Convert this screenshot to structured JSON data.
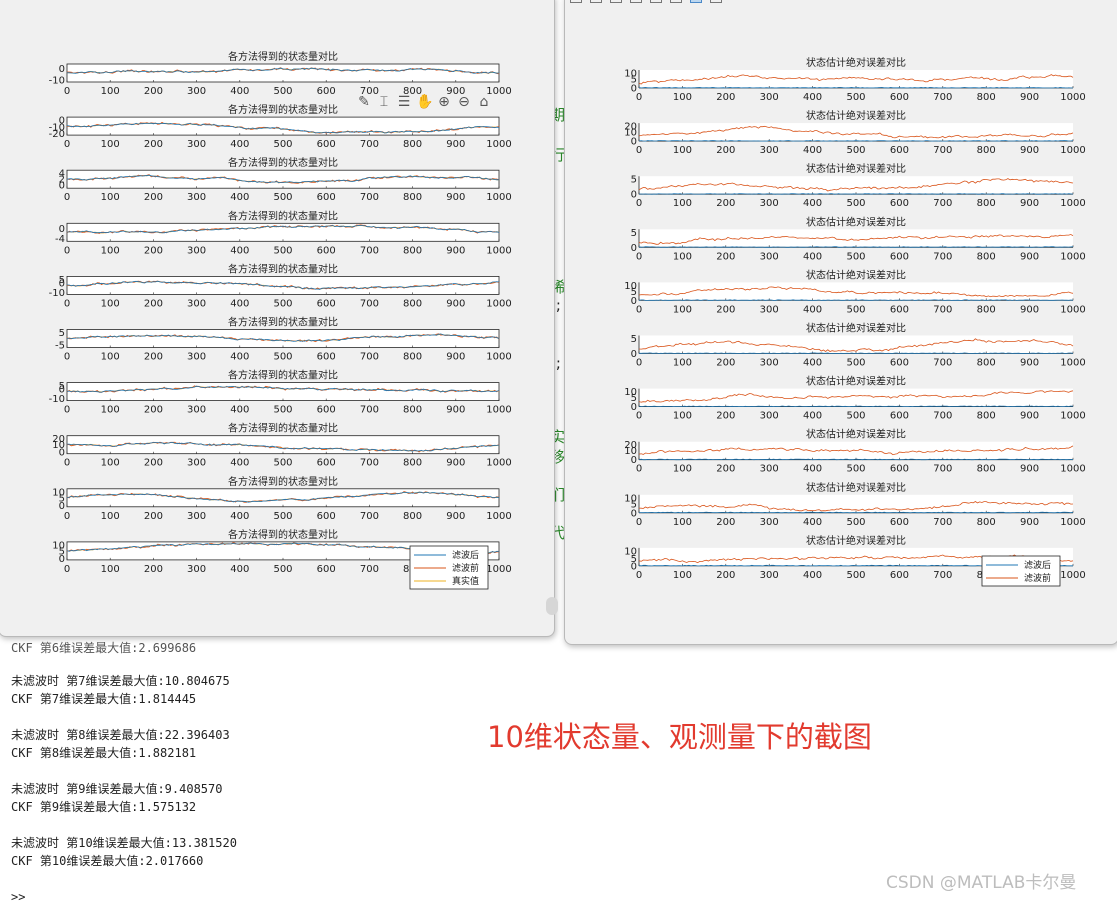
{
  "left_figure": {
    "plot_title": "各方法得到的状态量对比",
    "x_ticks": [
      0,
      100,
      200,
      300,
      400,
      500,
      600,
      700,
      800,
      900,
      1000
    ],
    "subplots": [
      {
        "y_ticks": [
          "0",
          "-10"
        ],
        "ylim": [
          -12,
          4
        ]
      },
      {
        "y_ticks": [
          "0",
          "-10",
          "-20"
        ],
        "ylim": [
          -22,
          4
        ]
      },
      {
        "y_ticks": [
          "4",
          "2",
          "0"
        ],
        "ylim": [
          -1,
          5
        ]
      },
      {
        "y_ticks": [
          "0",
          "-4"
        ],
        "ylim": [
          -5,
          2
        ]
      },
      {
        "y_ticks": [
          "5",
          "0",
          "-10"
        ],
        "ylim": [
          -12,
          7
        ]
      },
      {
        "y_ticks": [
          "5",
          "-5"
        ],
        "ylim": [
          -7,
          7
        ]
      },
      {
        "y_ticks": [
          "5",
          "0",
          "-10"
        ],
        "ylim": [
          -12,
          7
        ]
      },
      {
        "y_ticks": [
          "20",
          "10",
          "0"
        ],
        "ylim": [
          -2,
          22
        ]
      },
      {
        "y_ticks": [
          "10",
          "5",
          "0"
        ],
        "ylim": [
          -1,
          11
        ]
      },
      {
        "y_ticks": [
          "10",
          "5",
          "0"
        ],
        "ylim": [
          -1,
          11
        ]
      }
    ],
    "legend": [
      "滤波后",
      "滤波前",
      "真实值"
    ],
    "colors": {
      "after": "#1f77b4",
      "before": "#d9541a",
      "truth": "#edb120"
    }
  },
  "right_figure": {
    "plot_title": "状态估计绝对误差对比",
    "x_ticks": [
      0,
      100,
      200,
      300,
      400,
      500,
      600,
      700,
      800,
      900,
      1000
    ],
    "subplots": [
      {
        "y_ticks": [
          "10",
          "5",
          "0"
        ],
        "ylim": [
          0,
          10
        ]
      },
      {
        "y_ticks": [
          "20",
          "10",
          "0"
        ],
        "ylim": [
          0,
          20
        ]
      },
      {
        "y_ticks": [
          "5",
          "0"
        ],
        "ylim": [
          0,
          6
        ]
      },
      {
        "y_ticks": [
          "5",
          "0"
        ],
        "ylim": [
          0,
          6
        ]
      },
      {
        "y_ticks": [
          "10",
          "5",
          "0"
        ],
        "ylim": [
          0,
          10
        ]
      },
      {
        "y_ticks": [
          "5",
          "0"
        ],
        "ylim": [
          0,
          6
        ]
      },
      {
        "y_ticks": [
          "10",
          "5",
          "0"
        ],
        "ylim": [
          0,
          10
        ]
      },
      {
        "y_ticks": [
          "20",
          "10",
          "0"
        ],
        "ylim": [
          0,
          20
        ]
      },
      {
        "y_ticks": [
          "10",
          "5",
          "0"
        ],
        "ylim": [
          0,
          10
        ]
      },
      {
        "y_ticks": [
          "10",
          "5",
          "0"
        ],
        "ylim": [
          0,
          12
        ]
      }
    ],
    "legend": [
      "滤波后",
      "滤波前"
    ],
    "colors": {
      "after": "#1f77b4",
      "before": "#d9541a"
    }
  },
  "editor_fragments": [
    "期",
    "行",
    "稀",
    ");",
    ");",
    "实",
    "移",
    "们",
    "代"
  ],
  "console": {
    "lines": [
      "CKF 第6维误差最大值:2.699686",
      "",
      "未滤波时 第7维误差最大值:10.804675",
      "CKF 第7维误差最大值:1.814445",
      "",
      "未滤波时 第8维误差最大值:22.396403",
      "CKF 第8维误差最大值:1.882181",
      "",
      "未滤波时 第9维误差最大值:9.408570",
      "CKF 第9维误差最大值:1.575132",
      "",
      "未滤波时 第10维误差最大值:13.381520",
      "CKF 第10维误差最大值:2.017660"
    ],
    "prompt": ">>"
  },
  "annotation": "10维状态量、观测量下的截图",
  "watermark": "CSDN @MATLAB卡尔曼"
}
